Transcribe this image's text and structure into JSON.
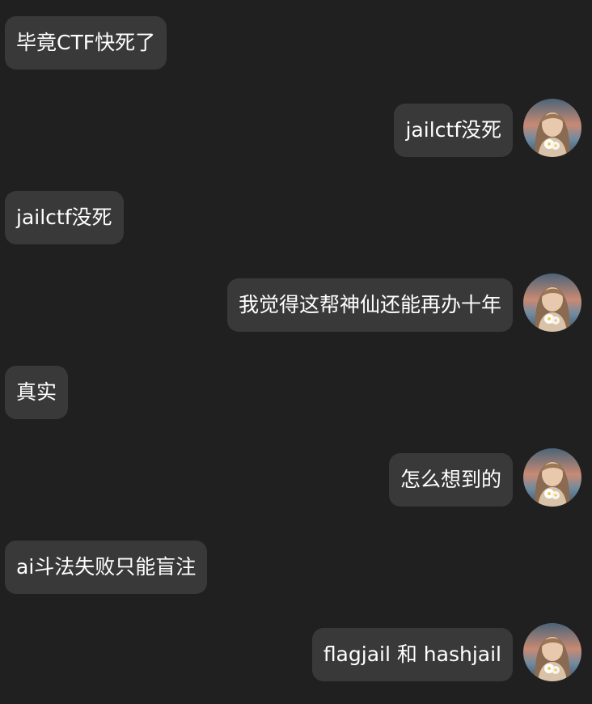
{
  "messages": [
    {
      "side": "left",
      "text": "毕竟CTF快死了"
    },
    {
      "side": "right",
      "text": "jailctf没死",
      "avatar_icon": "user-avatar-icon"
    },
    {
      "side": "left",
      "text": "jailctf没死"
    },
    {
      "side": "right",
      "text": "我觉得这帮神仙还能再办十年",
      "avatar_icon": "user-avatar-icon"
    },
    {
      "side": "left",
      "text": "真实"
    },
    {
      "side": "right",
      "text": "怎么想到的",
      "avatar_icon": "user-avatar-icon"
    },
    {
      "side": "left",
      "text": "ai斗法失败只能盲注"
    },
    {
      "side": "right",
      "text": "flagjail 和 hashjail",
      "avatar_icon": "user-avatar-icon"
    }
  ],
  "colors": {
    "background": "#202020",
    "bubble": "#393939",
    "text": "#ffffff"
  }
}
